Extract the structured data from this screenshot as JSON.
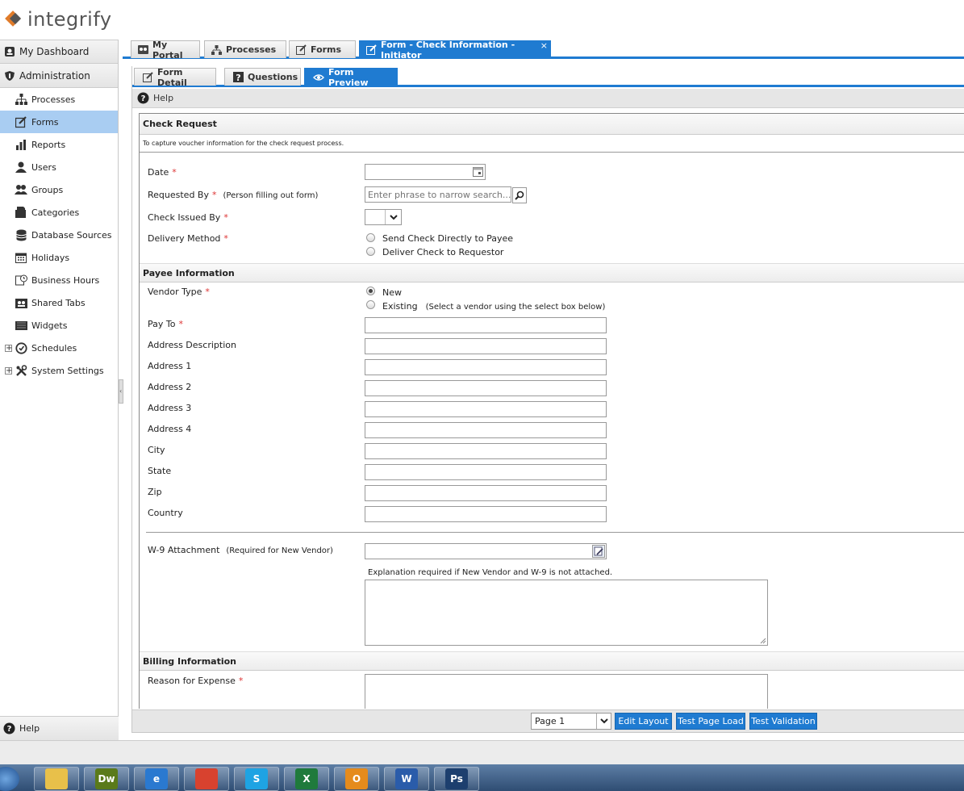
{
  "app": {
    "logo_text": "integrify"
  },
  "sidebar": {
    "top_items": [
      {
        "label": "My Dashboard",
        "icon": "dashboard-icon"
      },
      {
        "label": "Administration",
        "icon": "shield-icon"
      }
    ],
    "items": [
      {
        "label": "Processes",
        "icon": "org-chart-icon",
        "active": false
      },
      {
        "label": "Forms",
        "icon": "edit-form-icon",
        "active": true
      },
      {
        "label": "Reports",
        "icon": "bar-chart-icon",
        "active": false
      },
      {
        "label": "Users",
        "icon": "user-icon",
        "active": false
      },
      {
        "label": "Groups",
        "icon": "group-icon",
        "active": false
      },
      {
        "label": "Categories",
        "icon": "folder-icon",
        "active": false
      },
      {
        "label": "Database Sources",
        "icon": "database-icon",
        "active": false
      },
      {
        "label": "Holidays",
        "icon": "calendar-icon",
        "active": false
      },
      {
        "label": "Business Hours",
        "icon": "clock-calendar-icon",
        "active": false
      },
      {
        "label": "Shared Tabs",
        "icon": "shared-tabs-icon",
        "active": false
      },
      {
        "label": "Widgets",
        "icon": "widget-icon",
        "active": false
      },
      {
        "label": "Schedules",
        "icon": "clock-icon",
        "active": false,
        "expandable": true
      },
      {
        "label": "System Settings",
        "icon": "tools-icon",
        "active": false,
        "expandable": true
      }
    ],
    "help_label": "Help"
  },
  "tabs": [
    {
      "label": "My Portal",
      "icon": "portal-icon"
    },
    {
      "label": "Processes",
      "icon": "org-chart-icon"
    },
    {
      "label": "Forms",
      "icon": "edit-form-icon"
    },
    {
      "label": "Form - Check Information - Initiator",
      "icon": "edit-form-icon",
      "active": true,
      "close": "×"
    }
  ],
  "subtabs": [
    {
      "label": "Form Detail",
      "icon": "edit-form-icon"
    },
    {
      "label": "Questions",
      "icon": "question-icon"
    },
    {
      "label": "Form Preview",
      "icon": "eye-icon",
      "active": true
    }
  ],
  "help_bar": {
    "label": "Help"
  },
  "form": {
    "title": "Check Request",
    "description": "To capture voucher information for the check request process.",
    "date_label": "Date",
    "requested_by_label": "Requested By",
    "requested_by_note": "(Person filling out form)",
    "requested_by_placeholder": "Enter phrase to narrow search...",
    "check_issued_by_label": "Check Issued By",
    "delivery_method_label": "Delivery Method",
    "delivery_options": [
      "Send Check Directly to Payee",
      "Deliver Check to Requestor"
    ],
    "payee_section": "Payee Information",
    "vendor_type_label": "Vendor Type",
    "vendor_options": [
      {
        "label": "New",
        "selected": true
      },
      {
        "label": "Existing",
        "note": "(Select a vendor using the select box below)",
        "selected": false
      }
    ],
    "pay_to_label": "Pay To",
    "address_fields": [
      "Address Description",
      "Address 1",
      "Address 2",
      "Address 3",
      "Address 4",
      "City",
      "State",
      "Zip",
      "Country"
    ],
    "w9_label": "W-9 Attachment",
    "w9_note": "(Required for New Vendor)",
    "w9_explanation": "Explanation required if New Vendor and W-9 is not attached.",
    "billing_section": "Billing Information",
    "reason_label": "Reason for Expense",
    "required_mark": "*"
  },
  "bottom_bar": {
    "page_select": "Page 1",
    "buttons": [
      "Edit Layout",
      "Test Page Load",
      "Test Validation"
    ]
  },
  "taskbar": {
    "apps": [
      {
        "label": "",
        "icon": "file-explorer-icon",
        "color": "#e8c04a"
      },
      {
        "label": "Dw",
        "icon": "dreamweaver-icon",
        "color": "#5a7a1a"
      },
      {
        "label": "e",
        "icon": "internet-explorer-icon",
        "color": "#2a79d0"
      },
      {
        "label": "",
        "icon": "chrome-icon",
        "color": "#d8422f"
      },
      {
        "label": "S",
        "icon": "skype-icon",
        "color": "#1ea3e3"
      },
      {
        "label": "X",
        "icon": "excel-icon",
        "color": "#1f7a3c"
      },
      {
        "label": "O",
        "icon": "outlook-icon",
        "color": "#e58b1c"
      },
      {
        "label": "W",
        "icon": "word-icon",
        "color": "#2a5caa"
      },
      {
        "label": "Ps",
        "icon": "photoshop-icon",
        "color": "#1d3f6e"
      }
    ]
  }
}
